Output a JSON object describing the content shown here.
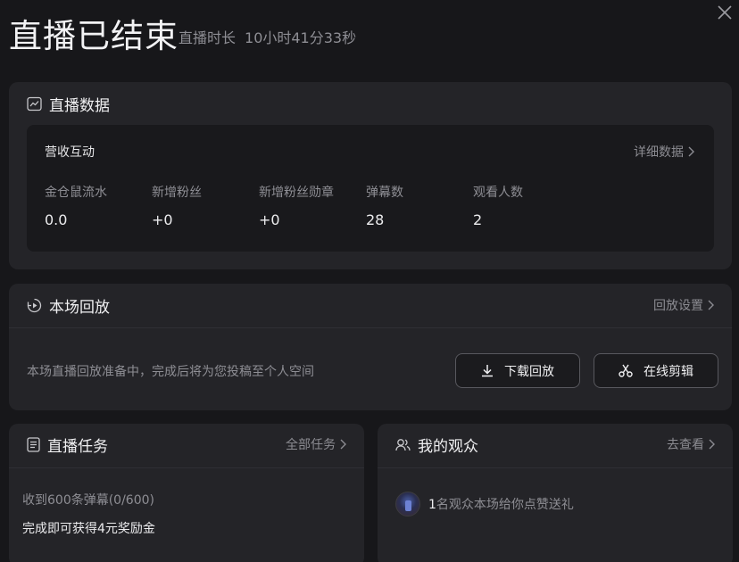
{
  "header": {
    "title": "直播已结束",
    "duration_label": "直播时长",
    "duration_value": "10小时41分33秒"
  },
  "live_data": {
    "title": "直播数据",
    "revenue": {
      "title": "营收互动",
      "detail_link": "详细数据",
      "metrics": [
        {
          "label": "金仓鼠流水",
          "value": "0.0"
        },
        {
          "label": "新增粉丝",
          "value": "+0"
        },
        {
          "label": "新增粉丝勋章",
          "value": "+0"
        },
        {
          "label": "弹幕数",
          "value": "28"
        },
        {
          "label": "观看人数",
          "value": "2"
        }
      ]
    }
  },
  "replay": {
    "title": "本场回放",
    "settings_link": "回放设置",
    "status_text": "本场直播回放准备中，完成后将为您投稿至个人空间",
    "download_label": "下载回放",
    "edit_label": "在线剪辑"
  },
  "tasks": {
    "title": "直播任务",
    "all_link": "全部任务",
    "progress_text": "收到600条弹幕(0/600)",
    "reward_text": "完成即可获得4元奖励金"
  },
  "audience": {
    "title": "我的观众",
    "view_link": "去查看",
    "count": "1",
    "desc": "名观众本场给你点赞送礼"
  }
}
